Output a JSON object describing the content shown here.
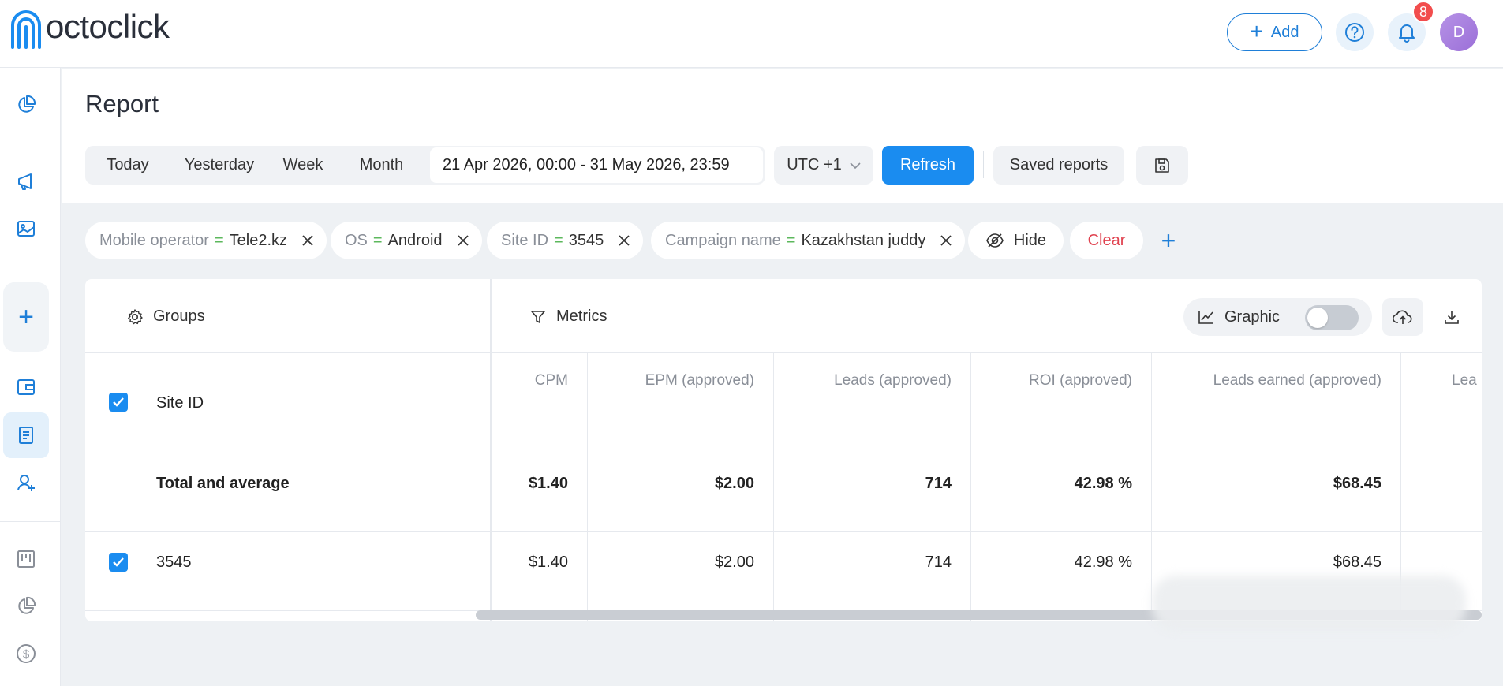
{
  "app": {
    "brand": "octoclick"
  },
  "header": {
    "add_label": "Add",
    "notifications_count": "8",
    "avatar_initial": "D"
  },
  "page": {
    "title": "Report"
  },
  "period": {
    "options": [
      "Today",
      "Yesterday",
      "Week",
      "Month"
    ],
    "date_range": "21 Apr 2026, 00:00 - 31 May 2026, 23:59",
    "timezone": "UTC +1",
    "refresh_label": "Refresh",
    "saved_reports_label": "Saved reports"
  },
  "filters": [
    {
      "key": "Mobile operator",
      "op": "=",
      "value": "Tele2.kz"
    },
    {
      "key": "OS",
      "op": "=",
      "value": "Android"
    },
    {
      "key": "Site ID",
      "op": "=",
      "value": "3545"
    },
    {
      "key": "Campaign name",
      "op": "=",
      "value": "Kazakhstan juddy"
    }
  ],
  "filter_actions": {
    "hide_label": "Hide",
    "clear_label": "Clear"
  },
  "table": {
    "groups_label": "Groups",
    "metrics_label": "Metrics",
    "graphic_label": "Graphic",
    "graphic_enabled": false,
    "group_column": "Site ID",
    "total_label": "Total and average",
    "columns": [
      "CPM",
      "EPM (approved)",
      "Leads (approved)",
      "ROI (approved)",
      "Leads earned (approved)",
      "Lea"
    ],
    "totals": [
      "$1.40",
      "$2.00",
      "714",
      "42.98 %",
      "$68.45",
      ""
    ],
    "rows": [
      {
        "id": "3545",
        "values": [
          "$1.40",
          "$2.00",
          "714",
          "42.98 %",
          "$68.45",
          ""
        ]
      }
    ]
  },
  "colors": {
    "accent": "#1a8cf0",
    "danger": "#e0424f",
    "equals": "#5cb85c"
  }
}
